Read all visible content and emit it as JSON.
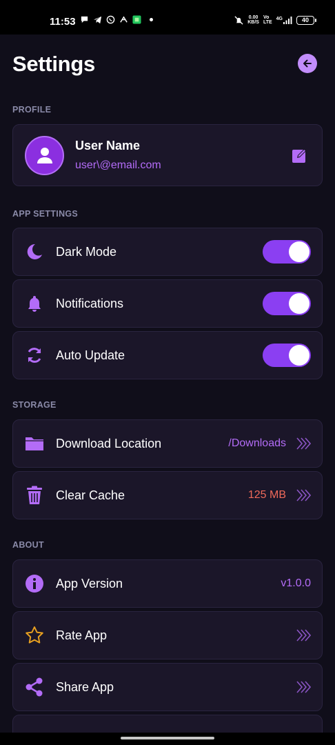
{
  "status_bar": {
    "time": "11:53",
    "net_speed_value": "0.00",
    "net_speed_unit": "KB/S",
    "volte_top": "Vo",
    "volte_bottom": "LTE",
    "signal_label": "4G",
    "battery": "40"
  },
  "header": {
    "title": "Settings"
  },
  "profile": {
    "section_title": "PROFILE",
    "name": "User Name",
    "email": "user\\@email.com"
  },
  "app_settings": {
    "section_title": "APP SETTINGS",
    "items": [
      {
        "label": "Dark Mode",
        "icon": "moon-icon",
        "enabled": true
      },
      {
        "label": "Notifications",
        "icon": "bell-icon",
        "enabled": true
      },
      {
        "label": "Auto Update",
        "icon": "sync-icon",
        "enabled": true
      }
    ]
  },
  "storage": {
    "section_title": "STORAGE",
    "items": [
      {
        "label": "Download Location",
        "value": "/Downloads",
        "icon": "folder-icon"
      },
      {
        "label": "Clear Cache",
        "value": "125 MB",
        "icon": "trash-icon"
      }
    ]
  },
  "about": {
    "section_title": "ABOUT",
    "items": [
      {
        "label": "App Version",
        "value": "v1.0.0",
        "icon": "info-icon"
      },
      {
        "label": "Rate App",
        "icon": "star-icon"
      },
      {
        "label": "Share App",
        "icon": "share-icon"
      }
    ]
  },
  "colors": {
    "background": "#100e1a",
    "card": "#1b1629",
    "accent": "#b36cf7",
    "toggle_on": "#8b3ff2",
    "cache_value": "#f06a5a",
    "star": "#e8a020",
    "section_title": "#8a8aa8"
  }
}
